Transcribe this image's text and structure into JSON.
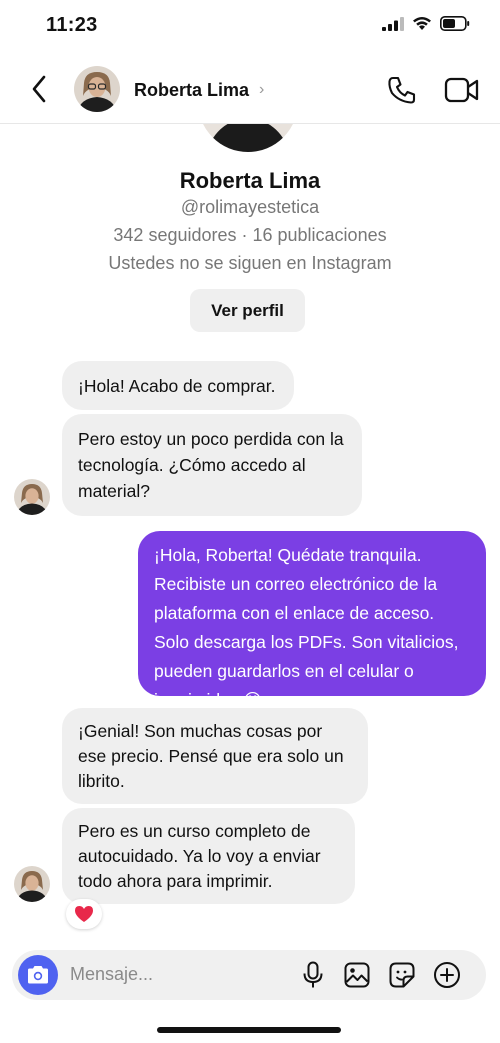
{
  "status_bar": {
    "time": "11:23"
  },
  "header": {
    "name": "Roberta Lima",
    "chevron": "›"
  },
  "profile": {
    "name": "Roberta Lima",
    "handle": "@rolimayestetica",
    "stats": "342 seguidores · 16 publicaciones",
    "follow_status": "Ustedes no se siguen en Instagram",
    "view_profile_label": "Ver perfil"
  },
  "messages": [
    {
      "sender": "them",
      "text": "¡Hola! Acabo de comprar."
    },
    {
      "sender": "them",
      "text": "Pero estoy un poco perdida con la tecnología. ¿Cómo accedo al material?"
    },
    {
      "sender": "me",
      "text": "¡Hola, Roberta! Quédate tranquila. Recibiste un correo electrónico de la plataforma con el enlace de acceso. Solo descarga los PDFs. Son vitalicios, pueden guardarlos en el celular o imprimirlos 😊"
    },
    {
      "sender": "them",
      "text": "¡Genial! Son muchas cosas por ese precio. Pensé que era solo un librito."
    },
    {
      "sender": "them",
      "text": "Pero es un curso completo de autocuidado. Ya lo voy a enviar todo ahora para imprimir."
    }
  ],
  "reaction": "❤️",
  "composer": {
    "placeholder": "Mensaje..."
  },
  "colors": {
    "outgoing_bubble": "#7b3fe4",
    "incoming_bubble": "#efefef",
    "camera_button": "#4f62f0"
  },
  "icons": [
    "back-icon",
    "phone-icon",
    "video-icon",
    "camera-icon",
    "microphone-icon",
    "image-icon",
    "sticker-icon",
    "plus-icon",
    "heart-icon"
  ]
}
